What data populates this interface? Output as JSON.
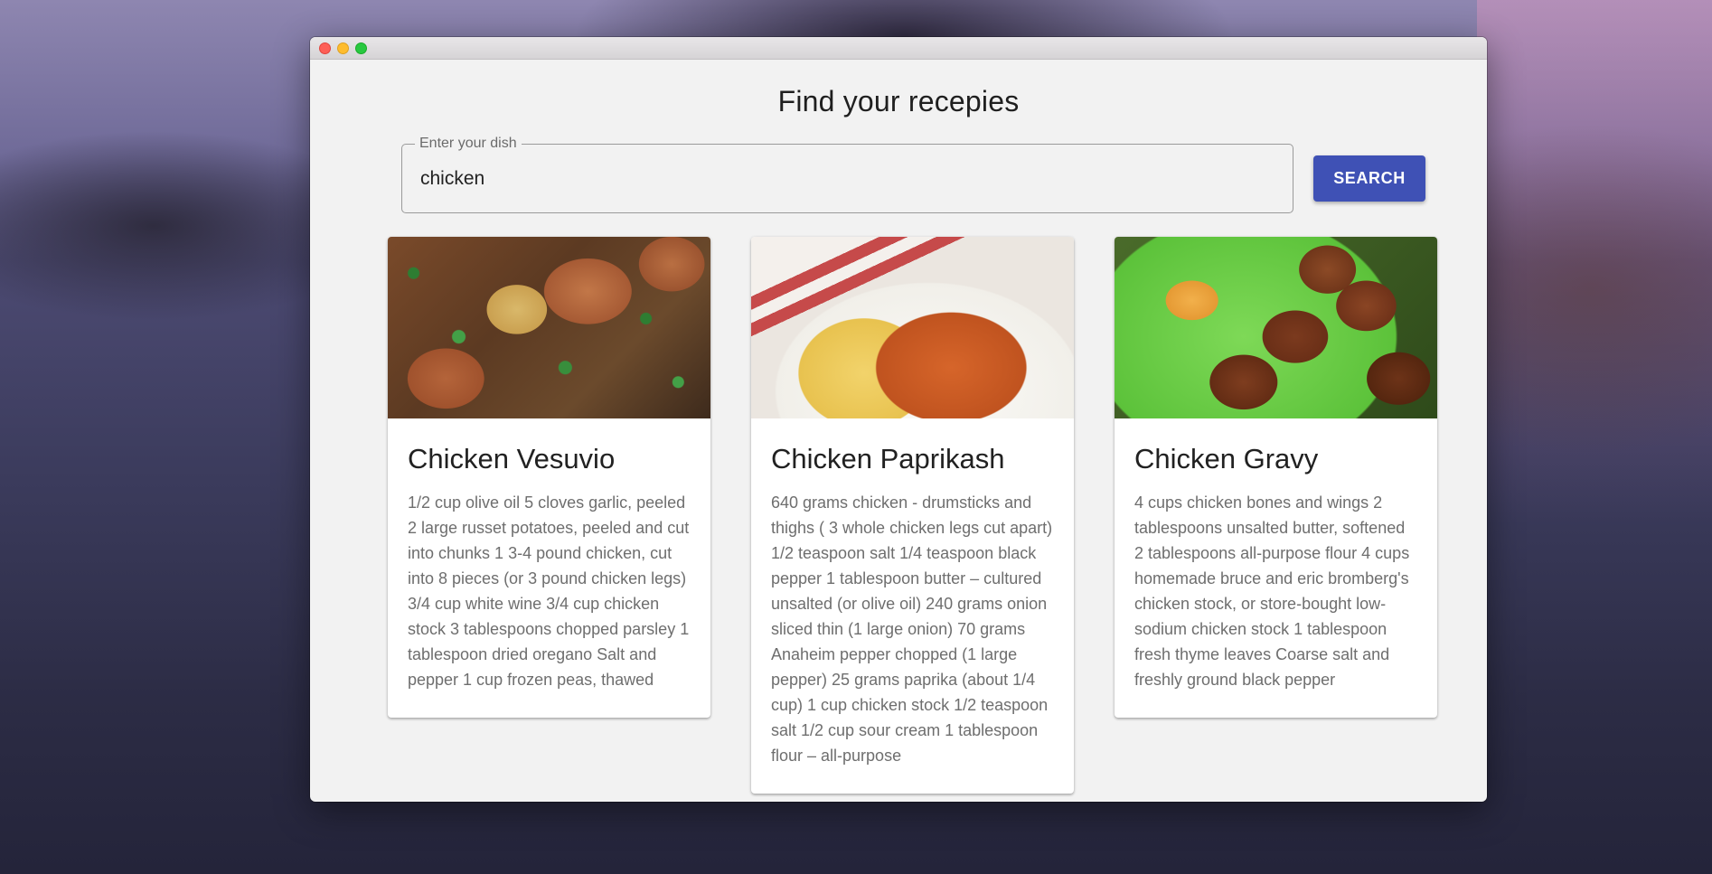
{
  "page": {
    "title": "Find your recepies"
  },
  "search": {
    "label": "Enter your dish",
    "value": "chicken",
    "button_label": "SEARCH"
  },
  "recipes": [
    {
      "title": "Chicken Vesuvio",
      "ingredients": "1/2 cup olive oil 5 cloves garlic, peeled 2 large russet potatoes, peeled and cut into chunks 1 3-4 pound chicken, cut into 8 pieces (or 3 pound chicken legs) 3/4 cup white wine 3/4 cup chicken stock 3 tablespoons chopped parsley 1 tablespoon dried oregano Salt and pepper 1 cup frozen peas, thawed"
    },
    {
      "title": "Chicken Paprikash",
      "ingredients": "640 grams chicken - drumsticks and thighs ( 3 whole chicken legs cut apart) 1/2 teaspoon salt 1/4 teaspoon black pepper 1 tablespoon butter – cultured unsalted (or olive oil) 240 grams onion sliced thin (1 large onion) 70 grams Anaheim pepper chopped (1 large pepper) 25 grams paprika (about 1/4 cup) 1 cup chicken stock 1/2 teaspoon salt 1/2 cup sour cream 1 tablespoon flour – all-purpose"
    },
    {
      "title": "Chicken Gravy",
      "ingredients": "4 cups chicken bones and wings 2 tablespoons unsalted butter, softened 2 tablespoons all-purpose flour 4 cups homemade bruce and eric bromberg's chicken stock, or store-bought low-sodium chicken stock 1 tablespoon fresh thyme leaves Coarse salt and freshly ground black pepper"
    }
  ]
}
